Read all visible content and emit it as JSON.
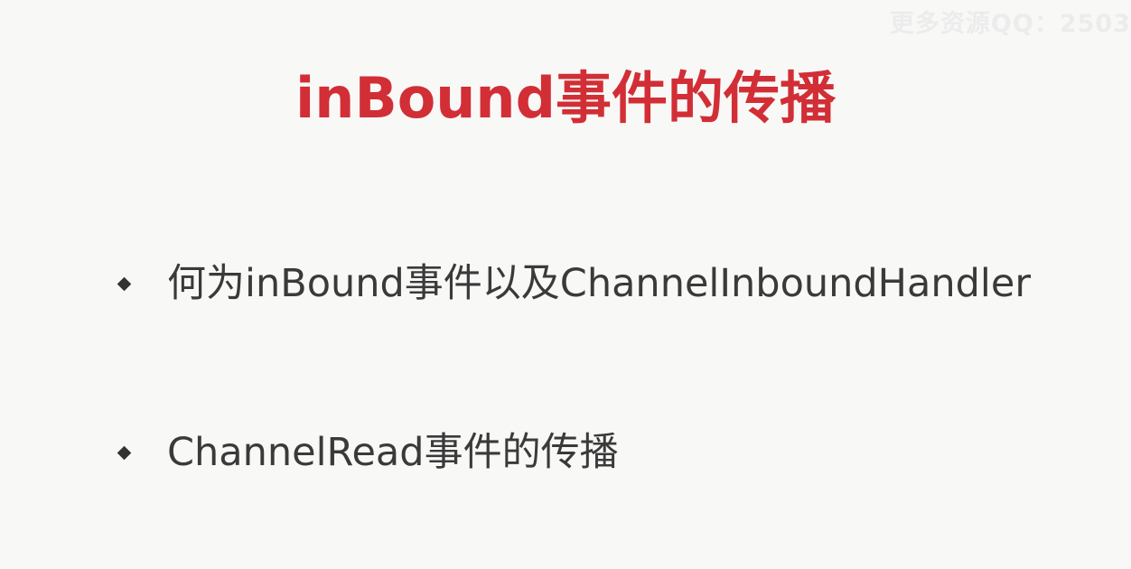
{
  "watermark": {
    "text": "更多资源QQ：2503"
  },
  "slide": {
    "title": "inBound事件的传播",
    "bullets": [
      {
        "text": "何为inBound事件以及ChannelInboundHandler",
        "icon": "diamond-bullet-icon"
      },
      {
        "text": "ChannelRead事件的传播",
        "icon": "diamond-bullet-icon"
      }
    ]
  },
  "colors": {
    "title": "#d22e36",
    "body_text": "#3a3a3a",
    "bullet": "#333333",
    "background": "#f8f8f7",
    "watermark": "#ececec"
  }
}
